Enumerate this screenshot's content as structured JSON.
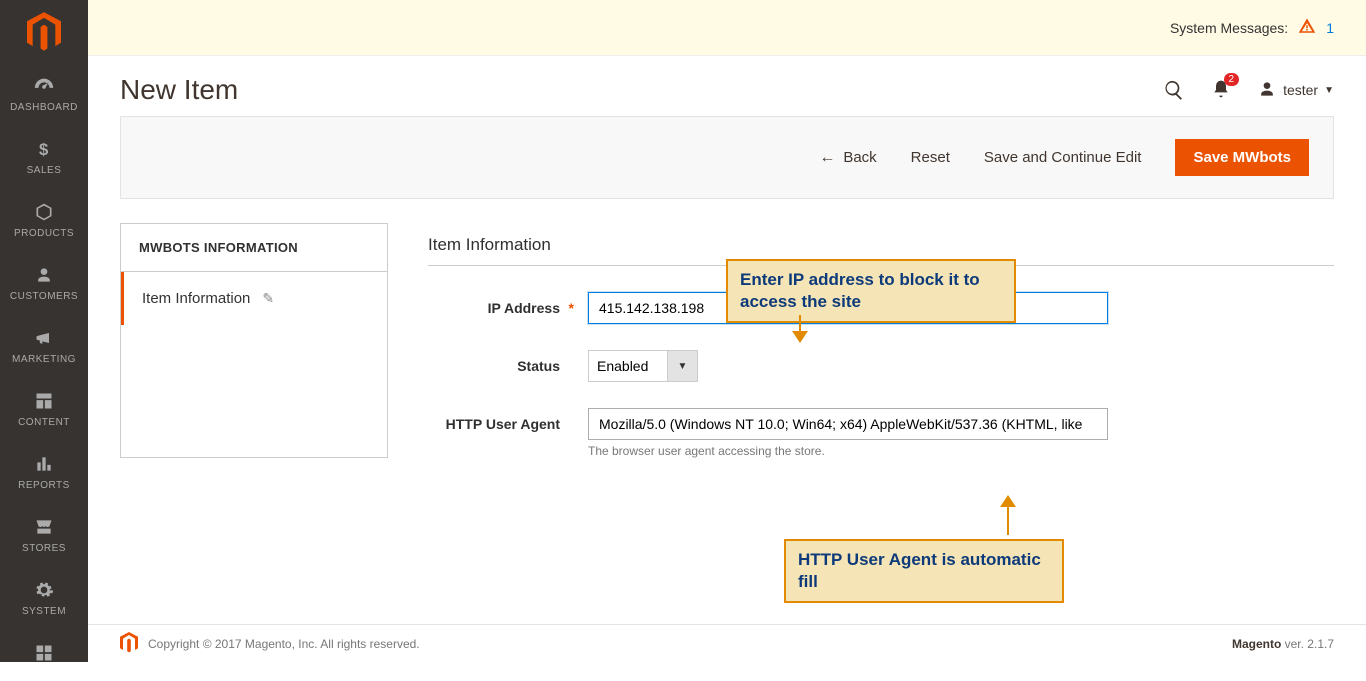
{
  "sidebar": {
    "items": [
      {
        "label": "DASHBOARD"
      },
      {
        "label": "SALES"
      },
      {
        "label": "PRODUCTS"
      },
      {
        "label": "CUSTOMERS"
      },
      {
        "label": "MARKETING"
      },
      {
        "label": "CONTENT"
      },
      {
        "label": "REPORTS"
      },
      {
        "label": "STORES"
      },
      {
        "label": "SYSTEM"
      }
    ]
  },
  "sysmsg": {
    "label": "System Messages:",
    "count": "1"
  },
  "header": {
    "title": "New Item",
    "user": "tester",
    "notif_count": "2"
  },
  "actions": {
    "back": "Back",
    "reset": "Reset",
    "save_continue": "Save and Continue Edit",
    "save": "Save MWbots"
  },
  "sidepanel": {
    "head": "MWBOTS INFORMATION",
    "item": "Item Information"
  },
  "form": {
    "section_title": "Item Information",
    "ip_label": "IP Address",
    "ip_value": "415.142.138.198",
    "status_label": "Status",
    "status_value": "Enabled",
    "ua_label": "HTTP User Agent",
    "ua_value": "Mozilla/5.0 (Windows NT 10.0; Win64; x64) AppleWebKit/537.36 (KHTML, like",
    "ua_hint": "The browser user agent accessing the store."
  },
  "callouts": {
    "c1": "Enter IP address to block it to access the site",
    "c2": "HTTP User Agent is automatic fill"
  },
  "footer": {
    "copyright": "Copyright © 2017 Magento, Inc. All rights reserved.",
    "version_label": "Magento",
    "version": " ver. 2.1.7"
  }
}
